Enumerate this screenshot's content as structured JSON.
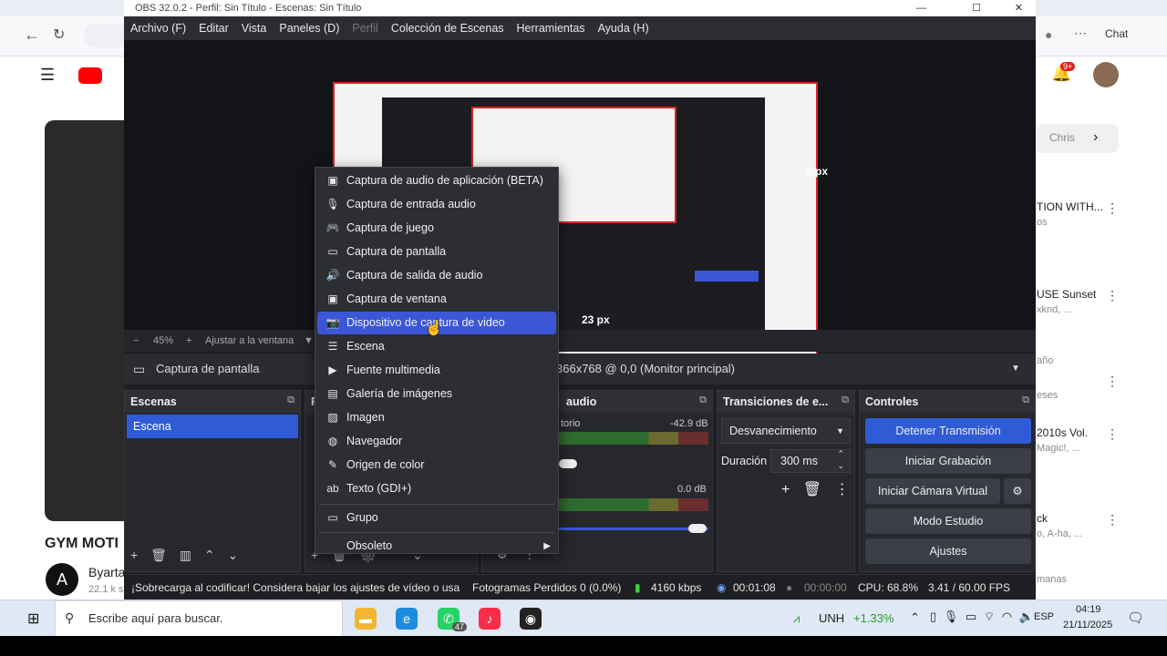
{
  "obs": {
    "title": "OBS 32.0.2 - Perfil: Sin Título - Escenas: Sin Título"
  },
  "menu": [
    "Archivo (F)",
    "Editar",
    "Vista",
    "Paneles (D)",
    "Perfil",
    "Colección de Escenas",
    "Herramientas",
    "Ayuda (H)"
  ],
  "zoom": {
    "minus": "−",
    "value": "45%",
    "plus": "+",
    "fit": "Ajustar a la ventana"
  },
  "source_bar": {
    "selected": "Captura de pantalla",
    "display": "366x768 @ 0,0 (Monitor principal)"
  },
  "preview_label": "23 px",
  "preview_label_right": "6 px",
  "context_menu": {
    "items": [
      {
        "label": "Captura de audio de aplicación (BETA)",
        "icon": "app-audio-icon",
        "glyph": "▣"
      },
      {
        "label": "Captura de entrada audio",
        "icon": "microphone-icon",
        "glyph": "🎙"
      },
      {
        "label": "Captura de juego",
        "icon": "gamepad-icon",
        "glyph": "🎮"
      },
      {
        "label": "Captura de pantalla",
        "icon": "monitor-icon",
        "glyph": "▭"
      },
      {
        "label": "Captura de salida de audio",
        "icon": "speaker-icon",
        "glyph": "🔊"
      },
      {
        "label": "Captura de ventana",
        "icon": "window-icon",
        "glyph": "▣"
      },
      {
        "label": "Dispositivo de captura de video",
        "icon": "camera-icon",
        "glyph": "📷"
      },
      {
        "label": "Escena",
        "icon": "list-icon",
        "glyph": "☰"
      },
      {
        "label": "Fuente multimedia",
        "icon": "play-icon",
        "glyph": "▶"
      },
      {
        "label": "Galería de imágenes",
        "icon": "gallery-icon",
        "glyph": "▤"
      },
      {
        "label": "Imagen",
        "icon": "image-icon",
        "glyph": "▨"
      },
      {
        "label": "Navegador",
        "icon": "globe-icon",
        "glyph": "◍"
      },
      {
        "label": "Origen de color",
        "icon": "brush-icon",
        "glyph": "✎"
      },
      {
        "label": "Texto (GDI+)",
        "icon": "text-icon",
        "glyph": "ab"
      },
      {
        "label": "Grupo",
        "icon": "folder-icon",
        "glyph": "▭"
      },
      {
        "label": "Obsoleto",
        "icon": "deprecated-icon",
        "glyph": ""
      }
    ],
    "submenu_arrow": "▶"
  },
  "scenes": {
    "header": "Escenas",
    "items": [
      "Escena"
    ]
  },
  "sources_header": "F",
  "audio": {
    "header": "audio",
    "ch1_name": "torio",
    "ch1_db": "-42.9 dB",
    "ch2_db": "0.0 dB",
    "scale": [
      "-5",
      "-5",
      "-5",
      "-5",
      "-20",
      "-15",
      "-10",
      "-5",
      "-0"
    ]
  },
  "transitions": {
    "header": "Transiciones de e...",
    "type": "Desvanecimiento",
    "duration_label": "Duración",
    "duration": "300 ms"
  },
  "controls": {
    "header": "Controles",
    "stop_stream": "Detener Transmisión",
    "start_rec": "Iniciar Grabación",
    "virtual_cam": "Iniciar Cámara Virtual",
    "studio": "Modo Estudio",
    "settings": "Ajustes"
  },
  "status": {
    "warning": "¡Sobrecarga al codificar! Considera bajar los ajustes de vídeo o usa",
    "dropped": "Fotogramas Perdidos 0 (0.0%)",
    "kbps": "4160 kbps",
    "live": "00:01:08",
    "rec": "00:00:00",
    "cpu": "CPU: 68.8%",
    "fps": "3.41 / 60.00 FPS"
  },
  "youtube": {
    "left_title": "GYM MOTI",
    "channel": "Byarta",
    "sub": "22.1 k s",
    "avatar": "A",
    "right": [
      {
        "t": "Chris",
        "s": ""
      },
      {
        "t": "TION WITH...",
        "s": "os"
      },
      {
        "t": "USE Sunset",
        "s": "xknd, ..."
      },
      {
        "t": "",
        "s": "año"
      },
      {
        "t": "",
        "s": "eses"
      },
      {
        "t": "2010s Vol.",
        "s": "Magic!, ..."
      },
      {
        "t": "ck",
        "s": "o, A-ha, ..."
      },
      {
        "t": "",
        "s": "manas"
      }
    ],
    "notif": "9+",
    "chat": "Chat"
  },
  "taskbar": {
    "search": "Escribe aquí para buscar.",
    "stock": "UNH",
    "stock_change": "+1.33%",
    "lang": "ESP",
    "time": "04:19",
    "date": "21/11/2025",
    "badge": "47"
  }
}
